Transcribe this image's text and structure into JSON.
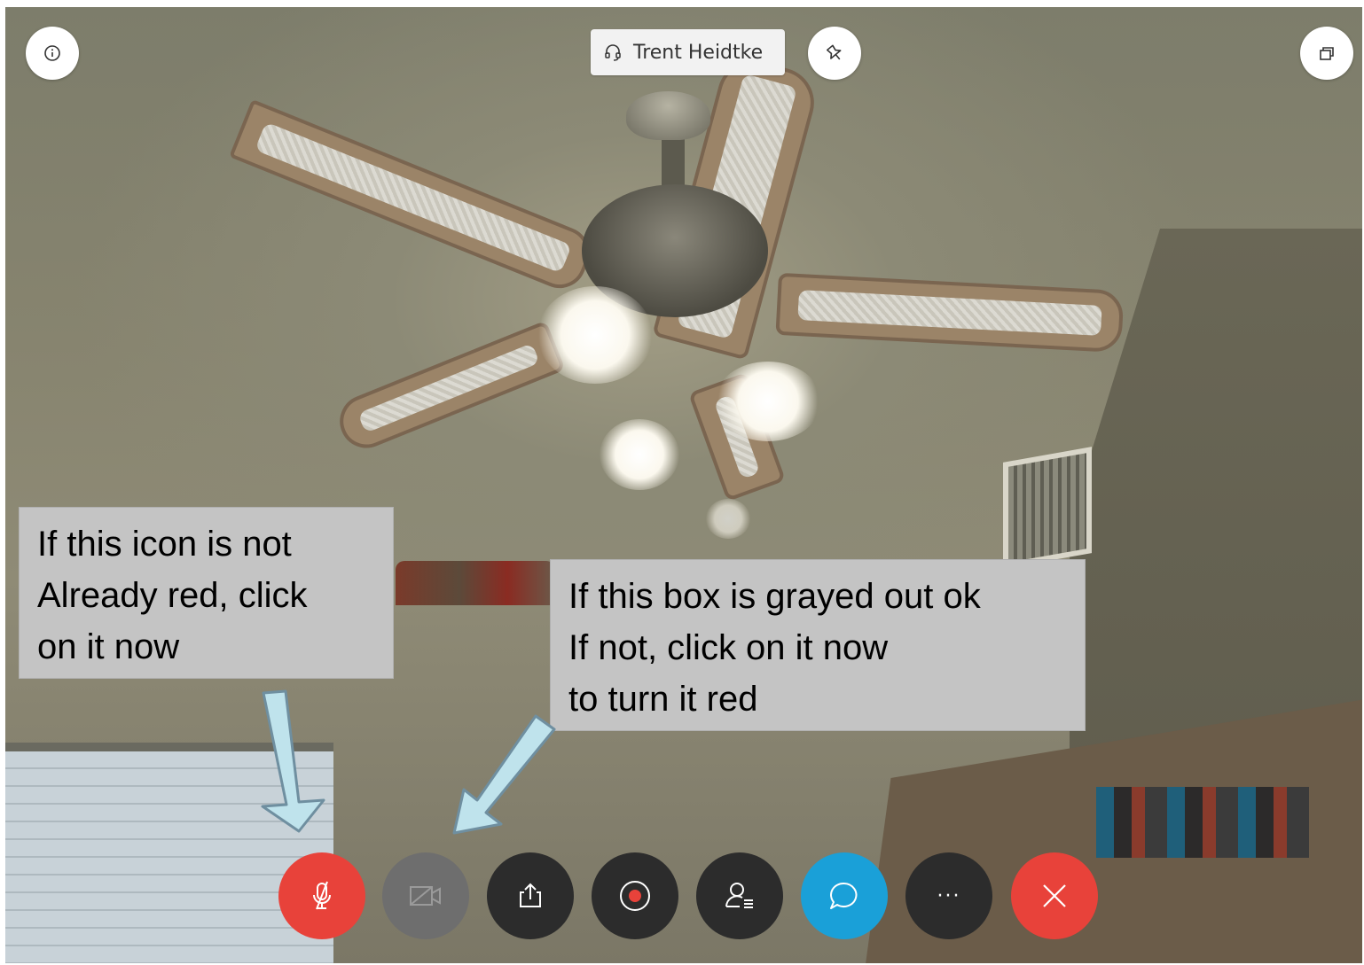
{
  "header": {
    "participant_name": "Trent Heidtke"
  },
  "icons": {
    "info": "info-icon",
    "headset": "headset-icon",
    "pin": "pin-icon",
    "window": "window-switch-icon",
    "mute": "microphone-muted-icon",
    "video": "video-off-icon",
    "share": "share-icon",
    "record": "record-icon",
    "participants": "participants-icon",
    "chat": "chat-icon",
    "more": "more-icon",
    "leave": "close-icon"
  },
  "toolbar": {
    "more_label": "···"
  },
  "annotations": {
    "mic_callout": [
      "If this icon is not",
      "Already red, click",
      "on it now"
    ],
    "video_callout": [
      "If this box is grayed out ok",
      "If not, click on it now",
      "to turn it red"
    ]
  },
  "colors": {
    "mute_active": "#e8423a",
    "video_off": "#6e6e6e",
    "toolbar_dark": "#2c2c2c",
    "chat": "#1aa0d8",
    "leave": "#e8423a",
    "callout_bg": "#c4c4c4",
    "arrow_fill": "#bfe3ec"
  }
}
